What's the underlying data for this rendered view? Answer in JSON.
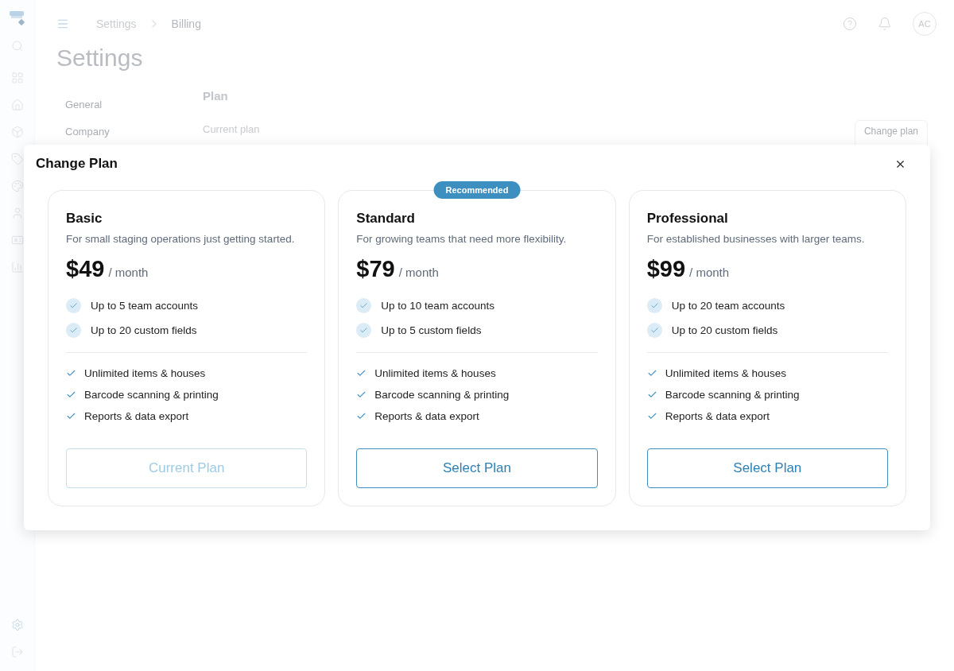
{
  "breadcrumb": [
    "Settings",
    "Billing"
  ],
  "header": {
    "avatar": "AC"
  },
  "page_title": "Settings",
  "settings_nav": [
    {
      "label": "General",
      "selected": false
    },
    {
      "label": "Company",
      "selected": false
    }
  ],
  "plan_section": {
    "title": "Plan",
    "current_label": "Current plan",
    "button": "Change plan"
  },
  "modal": {
    "title": "Change Plan",
    "plans": [
      {
        "name": "Basic",
        "description": "For small staging operations just getting started.",
        "price": "$49",
        "period": "/ month",
        "current": true,
        "features": [
          {
            "kind": "limit",
            "text": "Up to 5 team accounts"
          },
          {
            "kind": "limit",
            "text": "Up to 20 custom fields"
          },
          {
            "kind": "included",
            "text": "Unlimited items & houses"
          },
          {
            "kind": "included",
            "text": "Barcode scanning & printing"
          },
          {
            "kind": "included",
            "text": "Reports & data export"
          }
        ],
        "button": "Current Plan"
      },
      {
        "name": "Standard",
        "badge": "Recommended",
        "description": "For growing teams that need more flexibility.",
        "price": "$79",
        "period": "/ month",
        "current": false,
        "features": [
          {
            "kind": "limit",
            "text": "Up to 10 team accounts"
          },
          {
            "kind": "limit",
            "text": "Up to 5 custom fields"
          },
          {
            "kind": "included",
            "text": "Unlimited items & houses"
          },
          {
            "kind": "included",
            "text": "Barcode scanning & printing"
          },
          {
            "kind": "included",
            "text": "Reports & data export"
          }
        ],
        "button": "Select Plan"
      },
      {
        "name": "Professional",
        "description": "For established businesses with larger teams.",
        "price": "$99",
        "period": "/ month",
        "current": false,
        "features": [
          {
            "kind": "limit",
            "text": "Up to 20 team accounts"
          },
          {
            "kind": "limit",
            "text": "Up to 20 custom fields"
          },
          {
            "kind": "included",
            "text": "Unlimited items & houses"
          },
          {
            "kind": "included",
            "text": "Barcode scanning & printing"
          },
          {
            "kind": "included",
            "text": "Reports & data export"
          }
        ],
        "button": "Select Plan"
      }
    ]
  }
}
